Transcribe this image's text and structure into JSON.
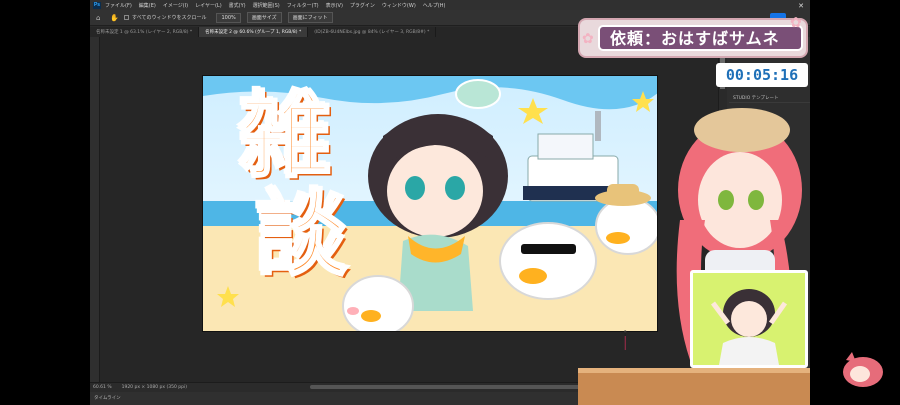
{
  "photoshop": {
    "menu": [
      "ファイル(F)",
      "編集(E)",
      "イメージ(I)",
      "レイヤー(L)",
      "書式(Y)",
      "選択範囲(S)",
      "フィルター(T)",
      "表示(V)",
      "プラグイン",
      "ウィンドウ(W)",
      "ヘルプ(H)"
    ],
    "options": {
      "scroll_all_label": "すべてのウィンドウをスクロール",
      "zoom_value": "100%",
      "fit_screen_label": "画面サイズ",
      "fill_screen_label": "画面にフィット"
    },
    "tabs": [
      {
        "label": "名称未設定 1 @ 63.1% (レイヤー 2, RGB/8) *",
        "active": false
      },
      {
        "label": "名称未設定 2 @ 60.6% (グループ 1, RGB/8) *",
        "active": true
      },
      {
        "label": "(ID)ZB-6U4NEIbs.jpg @ 84% (レイヤー 3, RGB/8#) *",
        "active": false
      }
    ],
    "panel_rows": [
      "STUDIO テンプレート"
    ],
    "status": {
      "zoom": "60.61 %",
      "doc_info": "1920 px × 1080 px (350 ppi)"
    },
    "timeline_label": "タイムライン"
  },
  "thumbnail": {
    "title_chars": [
      "雑",
      "談"
    ]
  },
  "overlay": {
    "request_label": "依頼：おはすばサムネ",
    "timer": "00:05:16"
  },
  "colors": {
    "orange": "#ff8a2a",
    "banner_purple": "#7a4f77",
    "timer_blue": "#1f70b8",
    "card_green": "#d8f270"
  }
}
